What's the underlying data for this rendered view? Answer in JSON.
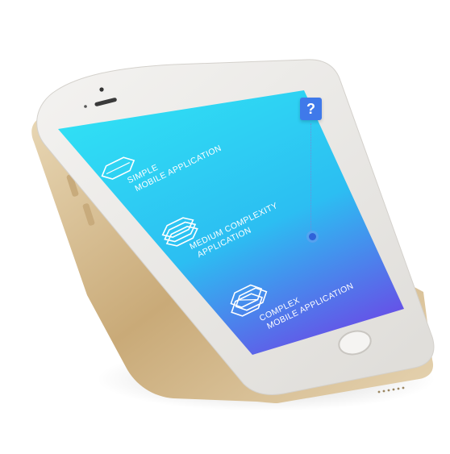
{
  "screen": {
    "items": [
      {
        "icon": "single-layer-hexagon-icon",
        "line1": "SIMPLE",
        "line2": "MOBILE APPLICATION"
      },
      {
        "icon": "stacked-layers-hexagon-icon",
        "line1": "MEDIUM COMPLEXITY",
        "line2": "APPLICATION"
      },
      {
        "icon": "complex-interlocked-hexagon-icon",
        "line1": "COMPLEX",
        "line2": "MOBILE APPLICATION"
      }
    ],
    "gradient": {
      "top": "#30e0f4",
      "middle": "#2cbef2",
      "bottom": "#6a49e6"
    }
  },
  "help": {
    "label": "?",
    "icon": "question-mark-icon",
    "color": "#3f79ea"
  },
  "phone": {
    "body_color": "#e8e6e2",
    "frame_color": "#d8c29a"
  }
}
